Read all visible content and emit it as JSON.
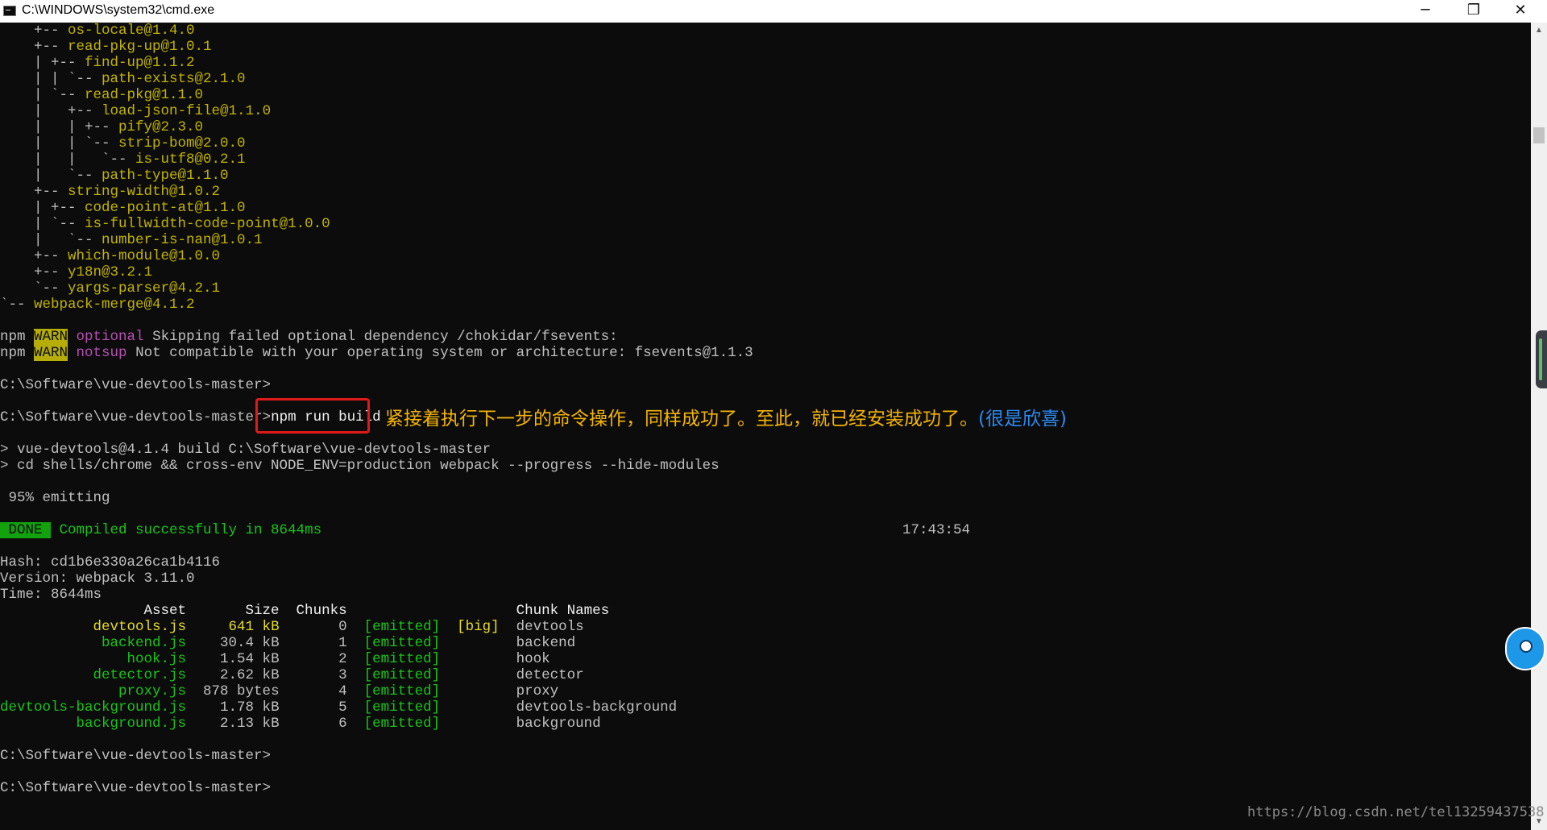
{
  "window": {
    "title": "C:\\WINDOWS\\system32\\cmd.exe",
    "minimize_glyph": "─",
    "maximize_glyph": "❐",
    "close_glyph": "✕"
  },
  "tree": [
    {
      "prefix": "    +-- ",
      "text": "os-locale@1.4.0"
    },
    {
      "prefix": "    +-- ",
      "text": "read-pkg-up@1.0.1"
    },
    {
      "prefix": "    | +-- ",
      "text": "find-up@1.1.2"
    },
    {
      "prefix": "    | | `-- ",
      "text": "path-exists@2.1.0"
    },
    {
      "prefix": "    | `-- ",
      "text": "read-pkg@1.1.0"
    },
    {
      "prefix": "    |   +-- ",
      "text": "load-json-file@1.1.0"
    },
    {
      "prefix": "    |   | +-- ",
      "text": "pify@2.3.0"
    },
    {
      "prefix": "    |   | `-- ",
      "text": "strip-bom@2.0.0"
    },
    {
      "prefix": "    |   |   `-- ",
      "text": "is-utf8@0.2.1"
    },
    {
      "prefix": "    |   `-- ",
      "text": "path-type@1.1.0"
    },
    {
      "prefix": "    +-- ",
      "text": "string-width@1.0.2"
    },
    {
      "prefix": "    | +-- ",
      "text": "code-point-at@1.1.0"
    },
    {
      "prefix": "    | `-- ",
      "text": "is-fullwidth-code-point@1.0.0"
    },
    {
      "prefix": "    |   `-- ",
      "text": "number-is-nan@1.0.1"
    },
    {
      "prefix": "    +-- ",
      "text": "which-module@1.0.0"
    },
    {
      "prefix": "    +-- ",
      "text": "y18n@3.2.1"
    },
    {
      "prefix": "    `-- ",
      "text": "yargs-parser@4.2.1"
    },
    {
      "prefix": "`-- ",
      "text": "webpack-merge@4.1.2"
    }
  ],
  "warn1": {
    "npm": "npm ",
    "level": "WARN",
    "tag": "optional",
    "msg": " Skipping failed optional dependency /chokidar/fsevents:"
  },
  "warn2": {
    "npm": "npm ",
    "level": "WARN",
    "tag": "notsup",
    "msg": " Not compatible with your operating system or architecture: fsevents@1.1.3"
  },
  "prompt": "C:\\Software\\vue-devtools-master>",
  "command": "npm run build",
  "annotation": {
    "main": "紧接着执行下一步的命令操作，同样成功了。至此，就已经安装成功了。",
    "paren": "(很是欣喜)"
  },
  "script_line1": "> vue-devtools@4.1.4 build C:\\Software\\vue-devtools-master",
  "script_line2": "> cd shells/chrome && cross-env NODE_ENV=production webpack --progress --hide-modules",
  "emitting": " 95% emitting",
  "done": {
    "badge": " DONE ",
    "msg": " Compiled successfully in 8644ms",
    "time": "17:43:54"
  },
  "hash_line": "Hash: cd1b6e330a26ca1b4116",
  "version_line": "Version: webpack 3.11.0",
  "time_line": "Time: 8644ms",
  "table": {
    "header": "                 Asset       Size  Chunks                    Chunk Names",
    "rows": [
      {
        "asset": "           devtools.js",
        "size": "     641 kB",
        "chunk": "       0",
        "status": "  [emitted]",
        "flag": "  [big]",
        "name": "  devtools"
      },
      {
        "asset": "            backend.js",
        "size": "    30.4 kB",
        "chunk": "       1",
        "status": "  [emitted]",
        "flag": "       ",
        "name": "  backend"
      },
      {
        "asset": "               hook.js",
        "size": "    1.54 kB",
        "chunk": "       2",
        "status": "  [emitted]",
        "flag": "       ",
        "name": "  hook"
      },
      {
        "asset": "           detector.js",
        "size": "    2.62 kB",
        "chunk": "       3",
        "status": "  [emitted]",
        "flag": "       ",
        "name": "  detector"
      },
      {
        "asset": "              proxy.js",
        "size": "  878 bytes",
        "chunk": "       4",
        "status": "  [emitted]",
        "flag": "       ",
        "name": "  proxy"
      },
      {
        "asset": "devtools-background.js",
        "size": "    1.78 kB",
        "chunk": "       5",
        "status": "  [emitted]",
        "flag": "       ",
        "name": "  devtools-background"
      },
      {
        "asset": "         background.js",
        "size": "    2.13 kB",
        "chunk": "       6",
        "status": "  [emitted]",
        "flag": "       ",
        "name": "  background"
      }
    ]
  },
  "scroll_up_glyph": "▲",
  "scroll_down_glyph": "▼",
  "watermark": "https://blog.csdn.net/tel13259437538"
}
